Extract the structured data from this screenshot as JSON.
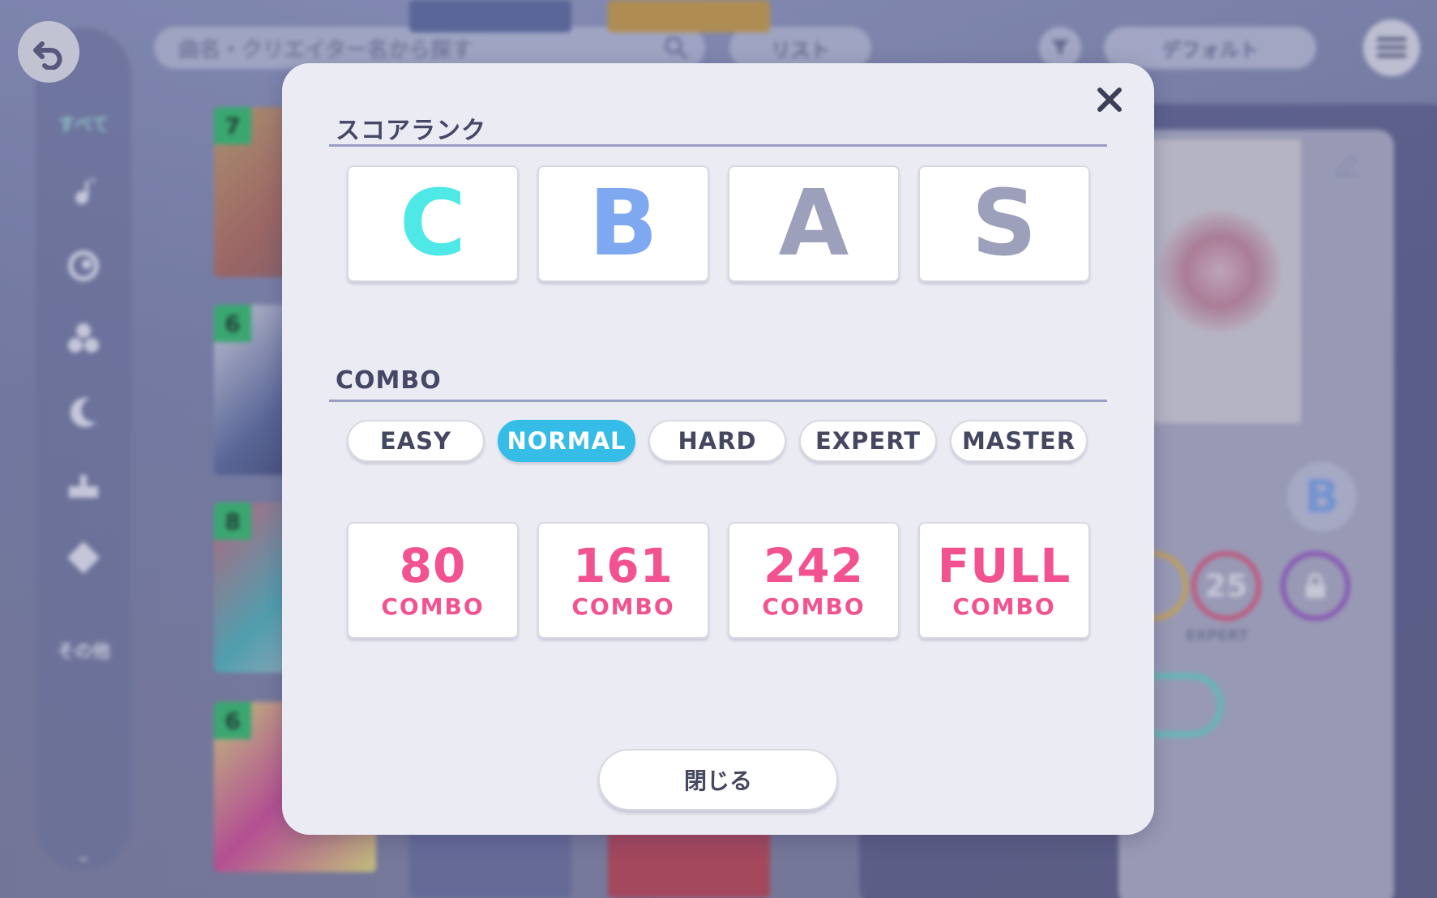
{
  "background": {
    "search_placeholder": "曲名・クリエイター名から探す",
    "list_toggle_label": "リスト",
    "sort_label": "デフォルト",
    "sidebar_all_label": "すべて",
    "sidebar_other_label": "その他",
    "card_levels": [
      "7",
      "6",
      "8",
      "6"
    ],
    "expert_level": "25",
    "expert_label": "EXPERT"
  },
  "modal": {
    "score_rank_title": "スコアランク",
    "ranks": [
      {
        "label": "C",
        "color": "#4ee8e6"
      },
      {
        "label": "B",
        "color": "#7ea8f0"
      },
      {
        "label": "A",
        "color": "#9da0bb"
      },
      {
        "label": "S",
        "color": "#9da0bb"
      }
    ],
    "combo_title": "COMBO",
    "difficulties": [
      "EASY",
      "NORMAL",
      "HARD",
      "EXPERT",
      "MASTER"
    ],
    "selected_difficulty": "NORMAL",
    "combo_thresholds": [
      {
        "value": "80",
        "label": "COMBO"
      },
      {
        "value": "161",
        "label": "COMBO"
      },
      {
        "value": "242",
        "label": "COMBO"
      },
      {
        "value": "FULL",
        "label": "COMBO"
      }
    ],
    "close_label": "閉じる"
  },
  "colors": {
    "accent": "#35bde7",
    "combo": "#f2528f"
  }
}
